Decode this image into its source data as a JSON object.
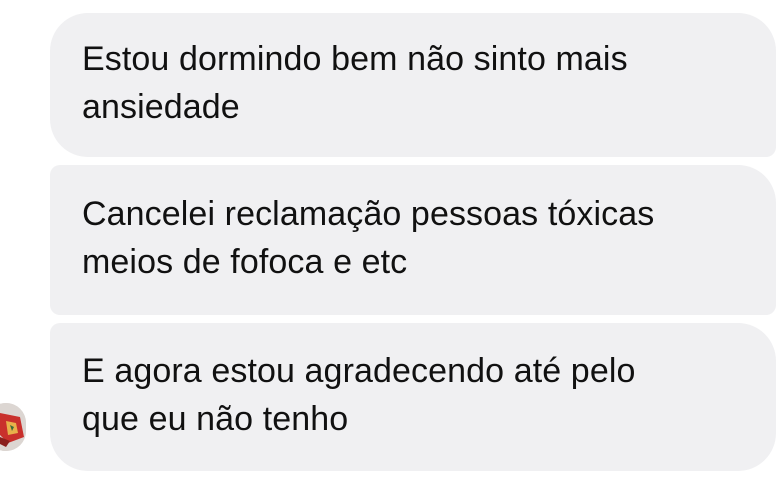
{
  "messages": [
    {
      "text": "Estou dormindo bem não sinto mais\nansiedade"
    },
    {
      "text": "Cancelei reclamação pessoas tóxicas\nmeios de fofoca e etc"
    },
    {
      "text": "E agora estou agradecendo até pelo\nque eu não tenho"
    }
  ],
  "colors": {
    "bubble_bg": "#f0f0f2",
    "text": "#111111"
  },
  "avatar": {
    "icon": "user-avatar-icon"
  }
}
